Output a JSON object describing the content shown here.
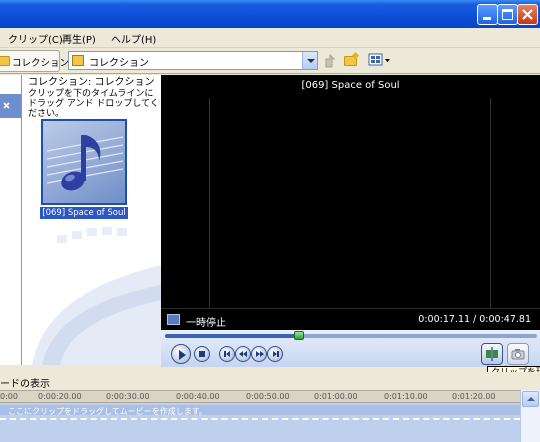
{
  "menu": {
    "clip": "クリップ(C)",
    "play": "再生(P)",
    "help": "ヘルプ(H)"
  },
  "toolbar": {
    "collections_button": "コレクション",
    "collection_selected": "コレクション"
  },
  "collection_pane": {
    "title": "コレクション: コレクション",
    "description": "クリップを下のタイムラインにドラッグ アンド ドロップしてください。",
    "clip_label": "[069] Space of Soul"
  },
  "preview": {
    "title": "[069] Space of Soul",
    "status": "一時停止",
    "time": "0:00:17.11 / 0:00:47.81",
    "progress": 0.36
  },
  "tooltip": {
    "text": "クリップを現在の位置で分割"
  },
  "storyboard": {
    "label": "ードの表示",
    "hint": "ここにクリップをドラッグしてムービーを作成します。",
    "ticks": [
      "0:00",
      "0:00:20.00",
      "0:00:30.00",
      "0:00:40.00",
      "0:00:50.00",
      "0:01:00.00",
      "0:01:10.00",
      "0:01:20.00"
    ]
  },
  "colors": {
    "titlebar": "#0A4ED6",
    "preview_bg": "#000000",
    "clip_label_bg": "#2A56C6"
  }
}
